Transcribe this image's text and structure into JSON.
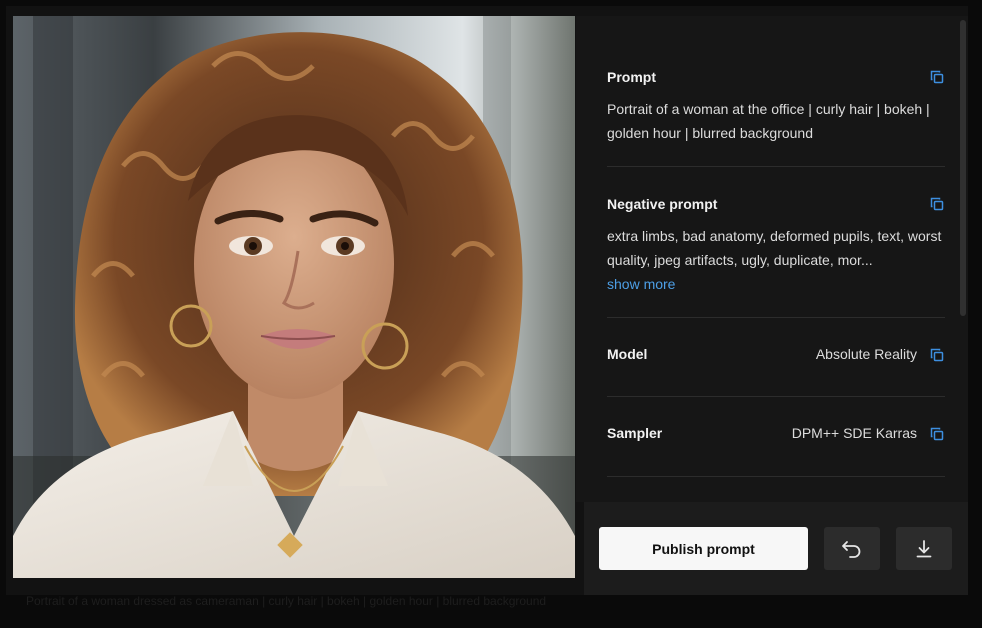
{
  "background_caption": "Portrait of a woman dressed as cameraman | curly hair | bokeh | golden hour | blurred background",
  "details": {
    "prompt": {
      "title": "Prompt",
      "text": "Portrait of a woman at the office | curly hair | bokeh | golden hour | blurred background"
    },
    "negative_prompt": {
      "title": "Negative prompt",
      "text": "extra limbs, bad anatomy, deformed pupils, text, worst quality, jpeg artifacts, ugly, duplicate, mor...",
      "show_more_label": "show more"
    },
    "model": {
      "label": "Model",
      "value": "Absolute Reality"
    },
    "sampler": {
      "label": "Sampler",
      "value": "DPM++ SDE Karras"
    }
  },
  "actions": {
    "publish_label": "Publish prompt",
    "undo_icon": "undo-icon",
    "download_icon": "download-icon"
  },
  "colors": {
    "link": "#4d9fe6",
    "copy_icon": "#3d8fe0",
    "panel_bg": "#161616",
    "action_bar_bg": "#1c1c1c"
  }
}
